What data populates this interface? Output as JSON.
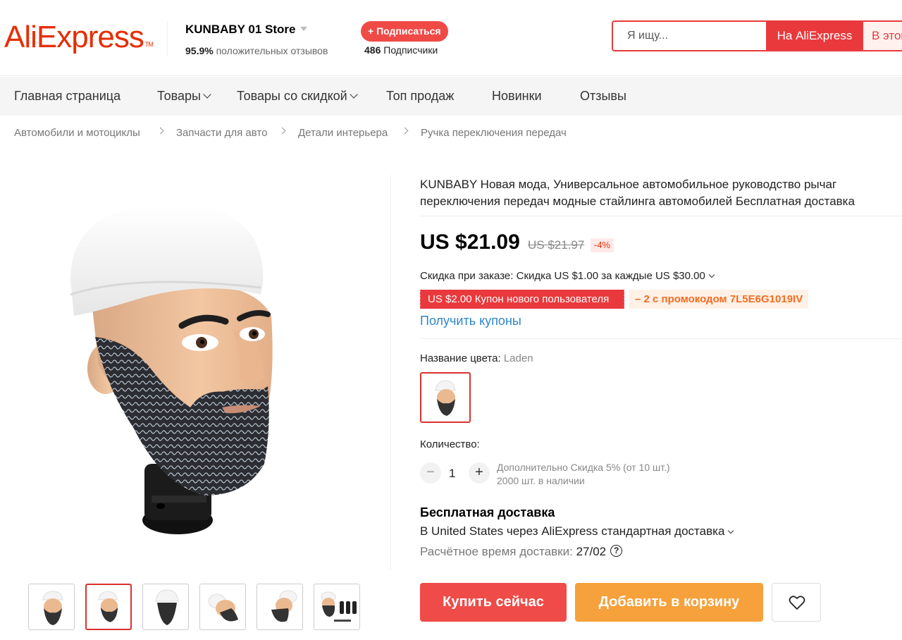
{
  "header": {
    "logo_text": "AliExpress",
    "store_name": "KUNBABY 01 Store",
    "rating_value": "95.9%",
    "rating_text": "положительных отзывов",
    "subscribe_label": "+ Подписаться",
    "subscribers_count": "486",
    "subscribers_text": "Подписчики",
    "search_placeholder": "Я ищу...",
    "search_on_ali": "На AliExpress",
    "search_in_store": "В этом"
  },
  "nav": {
    "items": [
      "Главная страница",
      "Товары",
      "Товары со скидкой",
      "Топ продаж",
      "Новинки",
      "Отзывы"
    ]
  },
  "breadcrumb": [
    "Автомобили и мотоциклы",
    "Запчасти для авто",
    "Детали интерьера",
    "Ручка переключения передач"
  ],
  "product": {
    "title": "KUNBABY Новая мода, Универсальное автомобильное руководство рычаг переключения передач модные стайлинга автомобилей Бесплатная доставка",
    "price": "US $21.09",
    "old_price": "US $21.97",
    "discount": "-4%",
    "order_discount": "Скидка при заказе: Скидка US $1.00 за каждые US $30.00",
    "coupon_new_user": "US $2.00 Купон нового пользователя",
    "promo_code": "– 2 с промокодом 7L5E6G1019IV",
    "get_coupons": "Получить купоны",
    "color_label": "Название цвета:",
    "color_value": "Laden",
    "quantity_label": "Количество:",
    "quantity": "1",
    "qty_discount_note": "Дополнительно Скидка 5% (от 10 шт.)",
    "stock_note": "2000 шт. в наличии",
    "shipping_title": "Бесплатная доставка",
    "shipping_method": "В United States через AliExpress стандартная доставка",
    "eta_label": "Расчётное время доставки:",
    "eta_value": "27/02",
    "buy_now": "Купить сейчас",
    "add_to_cart": "Добавить в корзину"
  },
  "colors": {
    "brand": "#e62e04",
    "buy": "#ef4b48",
    "cart": "#f6a13b",
    "link": "#2e87c8"
  }
}
